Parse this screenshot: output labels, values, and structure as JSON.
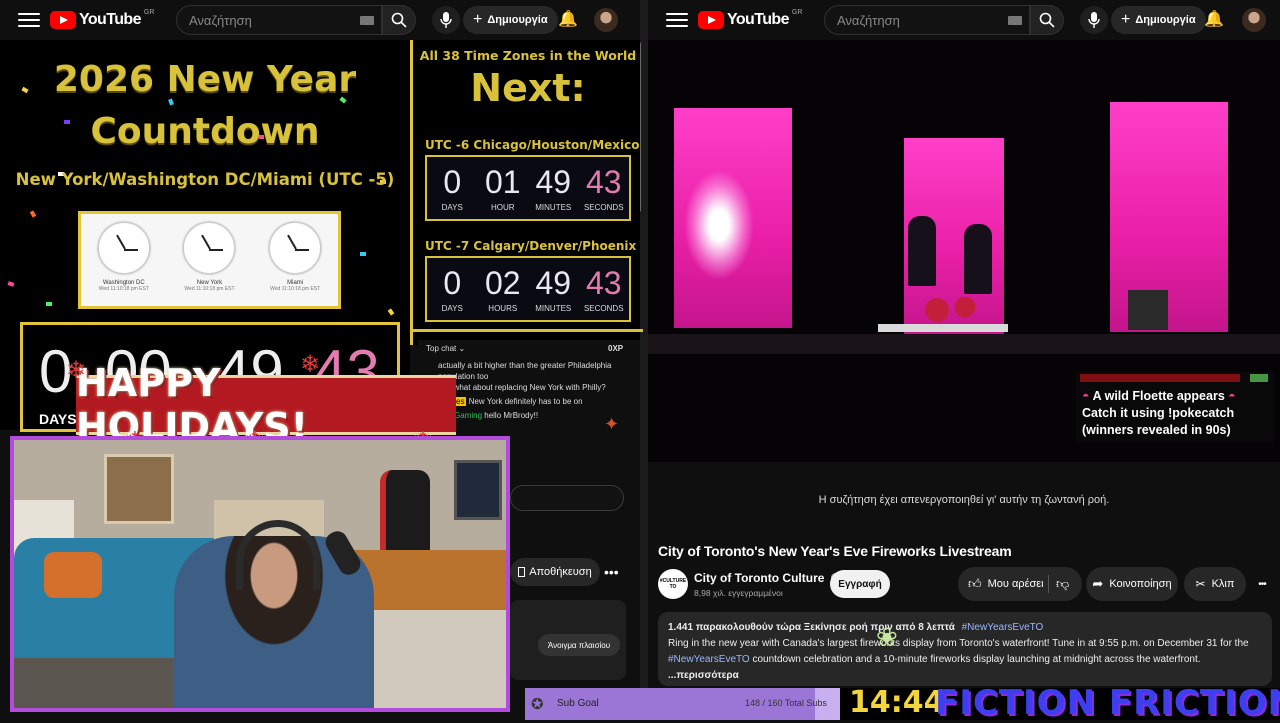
{
  "left_youtube": {
    "logo_text": "YouTube",
    "region": "GR",
    "search_placeholder": "Αναζήτηση",
    "create_label": "Δημιουργία"
  },
  "right_youtube": {
    "logo_text": "YouTube",
    "region": "GR",
    "search_placeholder": "Αναζήτηση",
    "create_label": "Δημιουργία"
  },
  "countdown": {
    "title_line1": "2026 New Year",
    "title_line2": "Countdown",
    "city_line": "New York/Washington DC/Miami (UTC -5)",
    "clocks": [
      {
        "city": "Washington DC",
        "time": "Wed 11:10:18 pm EST"
      },
      {
        "city": "New York",
        "time": "Wed 11:10:18 pm EST"
      },
      {
        "city": "Miami",
        "time": "Wed 11:10:18 pm EST"
      }
    ],
    "main_timer": {
      "days": "0",
      "hours": "00",
      "minutes": "49",
      "seconds": "43",
      "days_label": "DAYS"
    },
    "side_header": "All 38 Time Zones in the World",
    "next_label": "Next:",
    "zones": [
      {
        "label": "UTC -6 Chicago/Houston/Mexico",
        "days": "0",
        "hours": "01",
        "minutes": "49",
        "seconds": "43"
      },
      {
        "label": "UTC -7 Calgary/Denver/Phoenix",
        "days": "0",
        "hours": "02",
        "minutes": "49",
        "seconds": "43"
      }
    ],
    "unit_labels": {
      "days": "DAYS",
      "hour": "HOUR",
      "hours": "HOURS",
      "minutes": "MINUTES",
      "seconds": "SECONDS"
    }
  },
  "chat": {
    "header": "Top chat",
    "xp": "0XP",
    "lines": [
      "actually a bit higher than the greater Philadelphia",
      "population too",
      "372  what about replacing New York with Philly?",
      "New York definitely has to be on",
      "hello MrBrody!!"
    ],
    "badge": "Battles",
    "user_handle": "FamGaming"
  },
  "overlay": {
    "holidays_text": "HAPPY HOLIDAYS!",
    "sub_goal_label": "Sub Goal",
    "sub_goal_count": "148 / 160 Total Subs",
    "clock_time": "14:44",
    "channel_brand": "FICTION FRICTION"
  },
  "behind_overlay": {
    "save_label": "Αποθήκευση",
    "open_window_label": "Άνοιγμα πλαισίου"
  },
  "alert": {
    "line1": "A wild Floette appears",
    "line2": "Catch it using !pokecatch",
    "line3": "(winners revealed in 90s)"
  },
  "video": {
    "chat_disabled": "Η συζήτηση έχει απενεργοποιηθεί γι' αυτήν τη ζωντανή ροή.",
    "title": "City of Toronto's New Year's Eve Fireworks Livestream",
    "channel_name": "City of Toronto Culture",
    "subscribers": "8,98 χιλ. εγγεγραμμένοι",
    "subscribe_label": "Εγγραφή",
    "like_label": "Μου αρέσει",
    "share_label": "Κοινοποίηση",
    "clip_label": "Κλιπ",
    "avatar_text": "#CULTURE TO",
    "description": {
      "stats": "1.441 παρακολουθούν τώρα  Ξεκίνησε ροή πριν από 8 λεπτά",
      "hashtag": "#NewYearsEveTO",
      "body1": "Ring in the new year with Canada's largest fireworks display from Toronto's waterfront! Tune in at 9:55 p.m. on December 31 for the",
      "body2_tag": "#NewYearsEveTO",
      "body2": " countdown celebration and a 10-minute fireworks display launching at midnight across the waterfront.",
      "more": "...περισσότερα"
    }
  },
  "colors": {
    "gold": "#d8c23b",
    "youtube_red": "#ff0000",
    "stage_pink": "#ff3fc8",
    "webcam_border": "#b34bdc",
    "holiday_red": "#b31920"
  }
}
